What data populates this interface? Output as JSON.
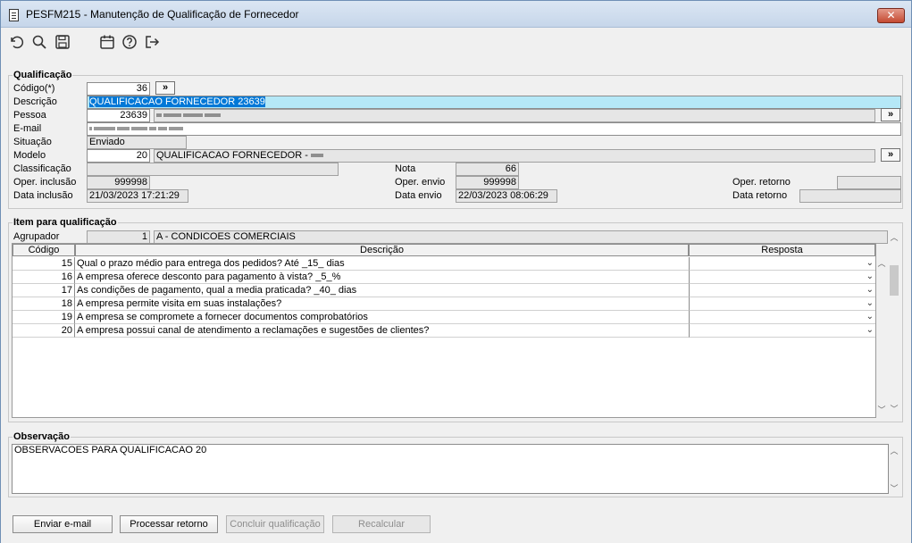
{
  "window": {
    "title": "PESFM215 - Manutenção de Qualificação de Fornecedor",
    "close_label": "✕"
  },
  "toolbar": {
    "icons": [
      "undo-icon",
      "search-icon",
      "save-icon",
      "calendar-icon",
      "help-icon",
      "exit-icon"
    ]
  },
  "qualificacao": {
    "legend": "Qualificação",
    "codigo_label": "Código(*)",
    "codigo": "36",
    "descricao_label": "Descrição",
    "descricao": "QUALIFICACAO FORNECEDOR 23639",
    "pessoa_label": "Pessoa",
    "pessoa": "23639",
    "email_label": "E-mail",
    "situacao_label": "Situação",
    "situacao": "Enviado",
    "modelo_label": "Modelo",
    "modelo": "20",
    "modelo_desc": "QUALIFICACAO FORNECEDOR -",
    "classificacao_label": "Classificação",
    "nota_label": "Nota",
    "nota": "66",
    "oper_inclusao_label": "Oper. inclusão",
    "oper_inclusao": "999998",
    "oper_envio_label": "Oper. envio",
    "oper_envio": "999998",
    "oper_retorno_label": "Oper. retorno",
    "data_inclusao_label": "Data inclusão",
    "data_inclusao": "21/03/2023 17:21:29",
    "data_envio_label": "Data envio",
    "data_envio": "22/03/2023 08:06:29",
    "data_retorno_label": "Data retorno",
    "lookup_label": "»"
  },
  "item": {
    "legend": "Item para qualificação",
    "agrupador_label": "Agrupador",
    "agrupador": "1",
    "agrupador_desc": "A - CONDICOES COMERCIAIS",
    "col_codigo": "Código",
    "col_descricao": "Descrição",
    "col_resposta": "Resposta",
    "rows": [
      {
        "code": "15",
        "desc": "Qual o prazo médio para entrega dos pedidos? Até _15_ dias"
      },
      {
        "code": "16",
        "desc": "A empresa oferece desconto para pagamento à vista? _5_%"
      },
      {
        "code": "17",
        "desc": "As condições de pagamento, qual a media praticada? _40_ dias"
      },
      {
        "code": "18",
        "desc": "A empresa permite visita em suas instalações?"
      },
      {
        "code": "19",
        "desc": "A empresa se compromete a fornecer documentos comprobatórios"
      },
      {
        "code": "20",
        "desc": "A empresa possui canal de atendimento a reclamações e sugestões de clientes?"
      }
    ]
  },
  "observacao": {
    "legend": "Observação",
    "text": "OBSERVACOES PARA QUALIFICACAO 20"
  },
  "buttons": {
    "enviar": "Enviar e-mail",
    "processar": "Processar retorno",
    "concluir": "Concluir qualificação",
    "recalcular": "Recalcular"
  }
}
